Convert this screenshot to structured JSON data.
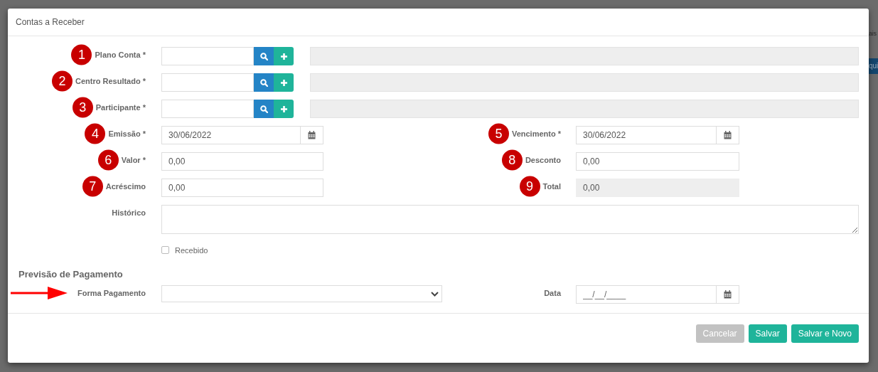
{
  "background": {
    "text": "ais",
    "button": "qui"
  },
  "modal": {
    "title": "Contas a Receber"
  },
  "lookup_fields": [
    {
      "label": "Plano Conta *",
      "marker": "1"
    },
    {
      "label": "Centro Resultado *",
      "marker": "2"
    },
    {
      "label": "Participante *",
      "marker": "3"
    }
  ],
  "field_rows": [
    {
      "left": {
        "label": "Emissão *",
        "marker": "4",
        "kind": "date",
        "value": "30/06/2022"
      },
      "right": {
        "label": "Vencimento *",
        "marker": "5",
        "kind": "date",
        "value": "30/06/2022"
      }
    },
    {
      "left": {
        "label": "Valor *",
        "marker": "6",
        "kind": "text",
        "value": "0,00"
      },
      "right": {
        "label": "Desconto",
        "marker": "8",
        "kind": "text",
        "value": "0,00"
      }
    },
    {
      "left": {
        "label": "Acréscimo",
        "marker": "7",
        "kind": "text",
        "value": "0,00"
      },
      "right": {
        "label": "Total",
        "marker": "9",
        "kind": "readonly",
        "value": "0,00"
      }
    }
  ],
  "historico": {
    "label": "Histórico"
  },
  "recebido": {
    "label": "Recebido",
    "checked": false
  },
  "section": {
    "title": "Previsão de Pagamento",
    "left": {
      "label": "Forma Pagamento",
      "kind": "select",
      "pointer_arrow": true
    },
    "right": {
      "label": "Data",
      "kind": "date",
      "placeholder": "__/__/____"
    }
  },
  "buttons": [
    {
      "label": "Cancelar",
      "kind": "secondary"
    },
    {
      "label": "Salvar",
      "kind": "primary"
    },
    {
      "label": "Salvar e Novo",
      "kind": "primary"
    }
  ]
}
